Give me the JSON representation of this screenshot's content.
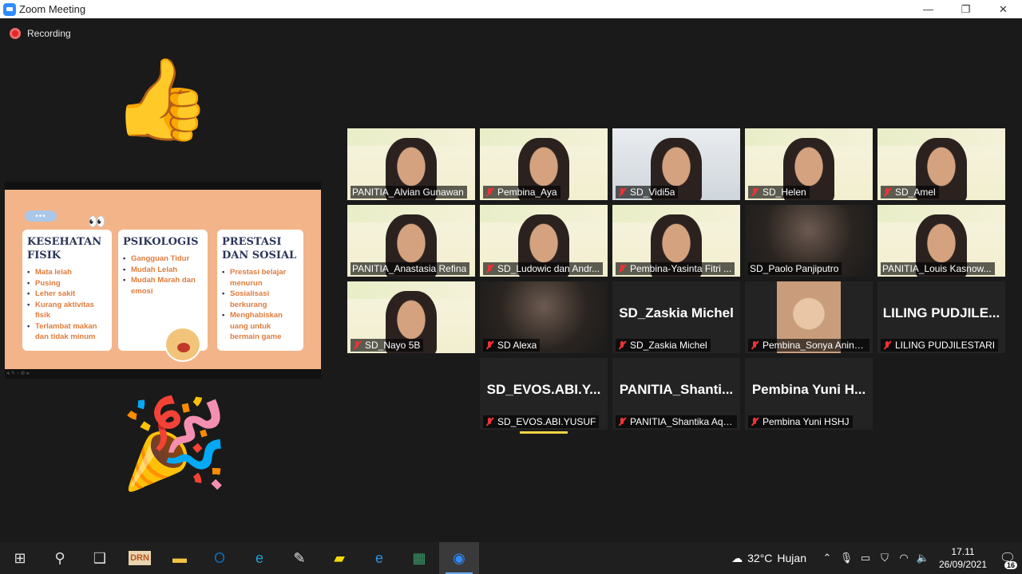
{
  "window": {
    "title": "Zoom Meeting",
    "controls": {
      "minimize": "—",
      "maximize": "❐",
      "close": "✕"
    }
  },
  "recording": {
    "label": "Recording",
    "color": "#e02828"
  },
  "reactions": {
    "thumbs": "👍",
    "party": "🎉"
  },
  "slide": {
    "pill": "•••",
    "eyes": "👀",
    "cards": [
      {
        "title_line1": "KESEHATAN",
        "title_line2": "FISIK",
        "items": [
          "Mata lelah",
          "Pusing",
          "Leher sakit",
          "Kurang aktivitas fisik",
          "Terlambat makan dan tidak minum"
        ]
      },
      {
        "title_line1": "PSIKOLOGIS",
        "title_line2": "",
        "items": [
          "Gangguan Tidur",
          "Mudah Lelah",
          "Mudah Marah dan emosi"
        ]
      },
      {
        "title_line1": "PRESTASI",
        "title_line2": "DAN SOSIAL",
        "items": [
          "Prestasi belajar menurun",
          "Sosialisasi berkurang",
          "Menghabiskan uang untuk bermain game"
        ]
      }
    ],
    "toolbar": "◂ ✎ ▫ ⊕ ▸"
  },
  "participants": [
    {
      "name": "PANITIA_Alvian Gunawan",
      "muted": false,
      "bg": "banner"
    },
    {
      "name": "Pembina_Aya",
      "muted": true,
      "bg": "banner"
    },
    {
      "name": "SD_Vidi5a",
      "muted": true,
      "bg": "room"
    },
    {
      "name": "SD_Helen",
      "muted": true,
      "bg": "banner"
    },
    {
      "name": "SD_Amel",
      "muted": true,
      "bg": "banner"
    },
    {
      "name": "PANITIA_Anastasia Refina",
      "muted": false,
      "bg": "banner"
    },
    {
      "name": "SD_Ludowic dan Andr...",
      "muted": true,
      "bg": "banner"
    },
    {
      "name": "Pembina-Yasinta Fitri ...",
      "muted": true,
      "bg": "banner"
    },
    {
      "name": "SD_Paolo Panjiputro",
      "muted": false,
      "bg": "dark"
    },
    {
      "name": "PANITIA_Louis Kasnow...",
      "muted": false,
      "bg": "banner"
    },
    {
      "name": "SD_Nayo 5B",
      "muted": true,
      "bg": "banner"
    },
    {
      "name": "SD Alexa",
      "muted": true,
      "bg": "dark"
    },
    {
      "name": "SD_Zaskia Michel",
      "muted": true,
      "bg": "none",
      "big": "SD_Zaskia Michel"
    },
    {
      "name": "Pembina_Sonya Anind...",
      "muted": true,
      "bg": "photo"
    },
    {
      "name": "LILING PUDJILESTARI",
      "muted": true,
      "bg": "none",
      "big": "LILING  PUDJILE..."
    },
    {
      "name": "SD_EVOS.ABI.YUSUF",
      "muted": true,
      "bg": "none",
      "big": "SD_EVOS.ABI.Y..."
    },
    {
      "name": "PANITIA_Shantika Aqill...",
      "muted": true,
      "bg": "none",
      "big": "PANITIA_Shanti..."
    },
    {
      "name": "Pembina Yuni HSHJ",
      "muted": true,
      "bg": "none",
      "big": "Pembina  Yuni  H..."
    }
  ],
  "taskbar": {
    "icons": [
      {
        "name": "start",
        "glyph": "⊞"
      },
      {
        "name": "search",
        "glyph": "⚲"
      },
      {
        "name": "task-view",
        "glyph": "❑"
      },
      {
        "name": "drn-app",
        "glyph": "DRN",
        "color": "#c0541e"
      },
      {
        "name": "file-explorer",
        "glyph": "▬",
        "color": "#f2c344"
      },
      {
        "name": "outlook",
        "glyph": "O",
        "color": "#0f6cbd"
      },
      {
        "name": "edge",
        "glyph": "e",
        "color": "#1fa0d8"
      },
      {
        "name": "paint",
        "glyph": "✎",
        "color": "#e6e6e6"
      },
      {
        "name": "sticky-notes",
        "glyph": "▰",
        "color": "#f5d90a"
      },
      {
        "name": "internet-explorer",
        "glyph": "e",
        "color": "#2a8ee0"
      },
      {
        "name": "matrix-app",
        "glyph": "▦",
        "color": "#3c9b6a"
      },
      {
        "name": "zoom",
        "glyph": "◉",
        "color": "#2d8cff"
      }
    ],
    "weather": {
      "temp": "32°C",
      "condition": "Hujan"
    },
    "clock": {
      "time": "17.11",
      "date": "26/09/2021"
    },
    "notifications": "16"
  }
}
